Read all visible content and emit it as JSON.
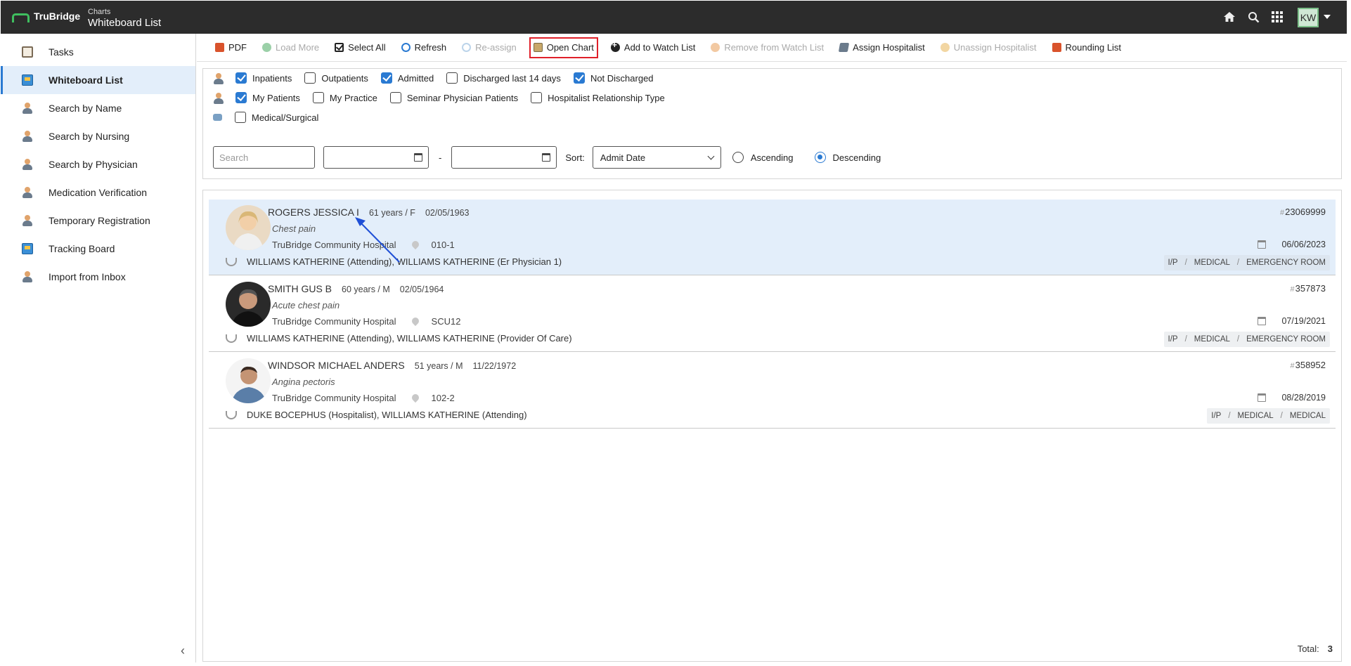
{
  "app": {
    "brand": "TruBridge",
    "crumb_parent": "Charts",
    "crumb_title": "Whiteboard List",
    "user_initials": "KW"
  },
  "sidebar": {
    "items": [
      {
        "label": "Tasks",
        "icon": "clipboard-icon"
      },
      {
        "label": "Whiteboard List",
        "icon": "whiteboard-icon",
        "active": true
      },
      {
        "label": "Search by Name",
        "icon": "person-icon"
      },
      {
        "label": "Search by Nursing",
        "icon": "person-icon"
      },
      {
        "label": "Search by Physician",
        "icon": "person-icon"
      },
      {
        "label": "Medication Verification",
        "icon": "person-icon"
      },
      {
        "label": "Temporary Registration",
        "icon": "person-icon"
      },
      {
        "label": "Tracking Board",
        "icon": "whiteboard-icon"
      },
      {
        "label": "Import from Inbox",
        "icon": "person-icon"
      }
    ]
  },
  "toolbar": {
    "pdf": "PDF",
    "load_more": "Load More",
    "select_all": "Select All",
    "refresh": "Refresh",
    "reassign": "Re-assign",
    "open_chart": "Open Chart",
    "add_watch": "Add to Watch List",
    "remove_watch": "Remove from Watch List",
    "assign_hosp": "Assign Hospitalist",
    "unassign_hosp": "Unassign Hospitalist",
    "rounding": "Rounding List"
  },
  "filters": {
    "inpatients": "Inpatients",
    "outpatients": "Outpatients",
    "admitted": "Admitted",
    "discharged14": "Discharged last 14 days",
    "not_discharged": "Not Discharged",
    "my_patients": "My Patients",
    "my_practice": "My Practice",
    "seminar": "Seminar Physician Patients",
    "hosp_rel": "Hospitalist Relationship Type",
    "med_surg": "Medical/Surgical",
    "search_placeholder": "Search",
    "dash": "-",
    "sort_label": "Sort:",
    "sort_value": "Admit Date",
    "ascending": "Ascending",
    "descending": "Descending"
  },
  "patients": [
    {
      "name": "ROGERS JESSICA I",
      "age": "61 years / F",
      "dob": "02/05/1963",
      "diagnosis": "Chest pain",
      "hospital": "TruBridge Community Hospital",
      "room": "010-1",
      "physicians": "WILLIAMS KATHERINE (Attending), WILLIAMS KATHERINE (Er Physician 1)",
      "hash": "#",
      "account": "23069999",
      "admit_date": "06/06/2023",
      "tag1": "I/P",
      "tag2": "MEDICAL",
      "tag3": "EMERGENCY ROOM",
      "sep": "/"
    },
    {
      "name": "SMITH GUS B",
      "age": "60 years / M",
      "dob": "02/05/1964",
      "diagnosis": "Acute chest pain",
      "hospital": "TruBridge Community Hospital",
      "room": "SCU12",
      "physicians": "WILLIAMS KATHERINE (Attending), WILLIAMS KATHERINE (Provider Of Care)",
      "hash": "#",
      "account": "357873",
      "admit_date": "07/19/2021",
      "tag1": "I/P",
      "tag2": "MEDICAL",
      "tag3": "EMERGENCY ROOM",
      "sep": "/"
    },
    {
      "name": "WINDSOR MICHAEL ANDERS",
      "age": "51 years / M",
      "dob": "11/22/1972",
      "diagnosis": "Angina pectoris",
      "hospital": "TruBridge Community Hospital",
      "room": "102-2",
      "physicians": "DUKE BOCEPHUS (Hospitalist), WILLIAMS KATHERINE (Attending)",
      "hash": "#",
      "account": "358952",
      "admit_date": "08/28/2019",
      "tag1": "I/P",
      "tag2": "MEDICAL",
      "tag3": "MEDICAL",
      "sep": "/"
    }
  ],
  "footer": {
    "total_label": "Total:",
    "total_value": "3"
  },
  "colors": {
    "accent": "#2a7ad2",
    "topbar": "#2c2c2c",
    "highlight_box": "#e0202a",
    "selected_row": "#e3eefa"
  }
}
